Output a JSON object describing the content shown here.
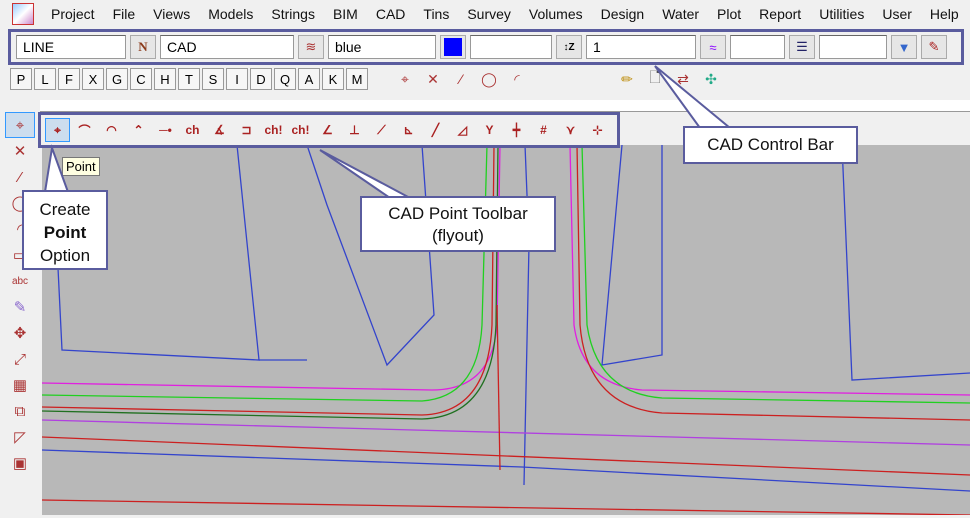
{
  "menu": [
    "Project",
    "File",
    "Views",
    "Models",
    "Strings",
    "BIM",
    "CAD",
    "Tins",
    "Survey",
    "Volumes",
    "Design",
    "Water",
    "Plot",
    "Report",
    "Utilities",
    "User",
    "Help"
  ],
  "control_bar": {
    "linestyle": "LINE",
    "model": "CAD",
    "colour": "blue",
    "colour_swatch": "#0000ff",
    "z_value": "",
    "name": "1",
    "weight": "",
    "style": ""
  },
  "letters": [
    "P",
    "L",
    "F",
    "X",
    "G",
    "C",
    "H",
    "T",
    "S",
    "I",
    "D",
    "Q",
    "A",
    "K",
    "M"
  ],
  "flyout_icons": [
    "point",
    "arc-3pt",
    "arc-centre",
    "arc-top",
    "line-point",
    "chainage",
    "angle",
    "offset",
    "chainage-text",
    "chainage-text-2",
    "bearing",
    "perp",
    "tangent",
    "distance",
    "line",
    "angle-2",
    "fork",
    "cross",
    "intersect",
    "branch",
    "extend"
  ],
  "tooltip": "Point",
  "callouts": {
    "control_bar": "CAD Control Bar",
    "point_toolbar_1": "CAD Point Toolbar",
    "point_toolbar_2": "(flyout)",
    "create_1": "Create",
    "create_2": "Point",
    "create_3": "Option"
  },
  "accent": "#5a5c9e"
}
